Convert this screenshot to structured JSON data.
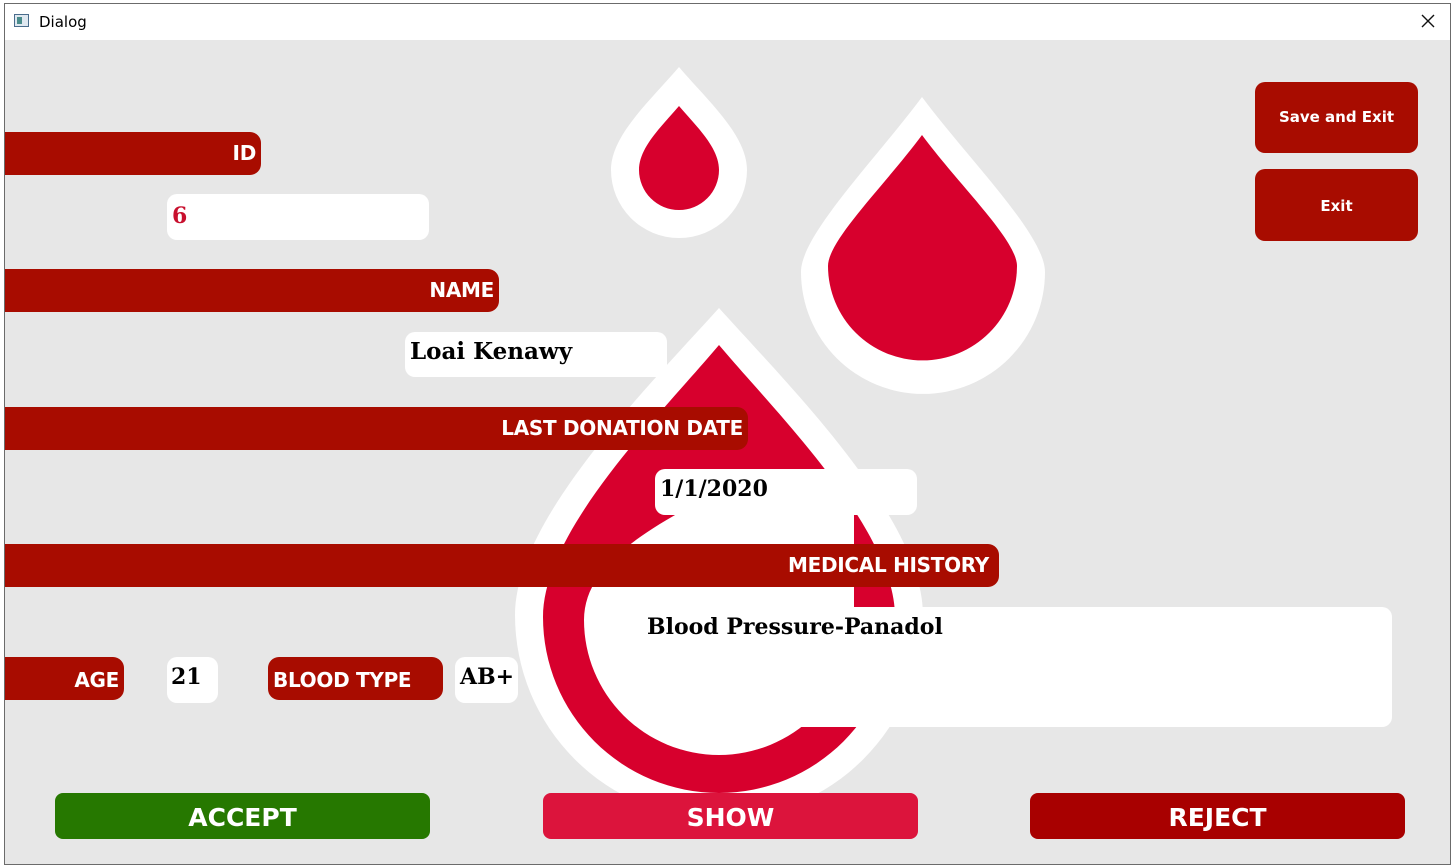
{
  "window": {
    "title": "Dialog"
  },
  "labels": {
    "id": "ID",
    "name": "NAME",
    "last_donation_date": "LAST DONATION DATE",
    "medical_history": "MEDICAL HISTORY",
    "age": "AGE",
    "blood_type": "BLOOD TYPE"
  },
  "fields": {
    "id": "6",
    "name": "Loai Kenawy",
    "last_donation_date": "1/1/2020",
    "medical_history": "Blood Pressure-Panadol",
    "age": "21",
    "blood_type": "AB+"
  },
  "buttons": {
    "save_and_exit": "Save and Exit",
    "exit": "Exit",
    "accept": "ACCEPT",
    "show": "SHOW",
    "reject": "REJECT"
  },
  "colors": {
    "label_red": "#a80c00",
    "drop_red": "#d7002d",
    "accept_green": "#267800",
    "show_pink": "#dc143c",
    "reject_red": "#a80000",
    "id_text_red": "#c8102e"
  },
  "icons": [
    "app-icon",
    "close-icon",
    "blood-drop-icon"
  ]
}
